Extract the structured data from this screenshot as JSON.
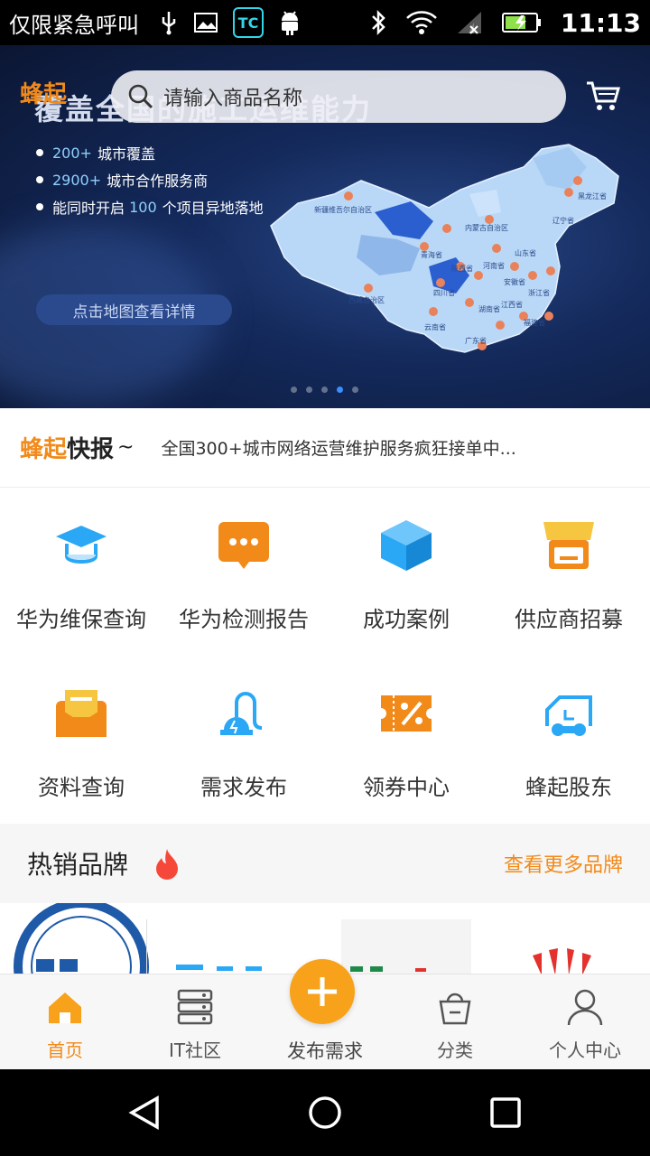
{
  "status_bar": {
    "carrier": "仅限紧急呼叫",
    "app_badge": "TC",
    "time": "11:13"
  },
  "banner": {
    "logo_text": "蜂起",
    "title": "覆盖全国的施工运维能力",
    "search_placeholder": "请输入商品名称",
    "bullets": [
      {
        "highlight": "200+",
        "text": "城市覆盖"
      },
      {
        "highlight": "2900+",
        "text": "城市合作服务商"
      },
      {
        "highlight": "100",
        "prefix": "能同时开启",
        "text": "个项目异地落地"
      }
    ],
    "map_button": "点击地图查看详情",
    "map_labels": [
      "新疆维吾尔自治区",
      "西藏自治区",
      "内蒙古自治区",
      "青海省",
      "四川省",
      "云南省",
      "广东省",
      "湖南省",
      "江西省",
      "浙江省",
      "山东省",
      "辽宁省",
      "黑龙江省",
      "陕西省",
      "河南省",
      "安徽省",
      "福建省"
    ],
    "carousel_pages": 5,
    "carousel_active": 4
  },
  "news": {
    "brand_orange": "蜂起",
    "brand_dark": "快报",
    "tilde": "~",
    "text": "全国300+城市网络运营维护服务疯狂接单中..."
  },
  "grid_items": [
    {
      "label": "华为维保查询",
      "icon": "graduation-cap-icon",
      "color": "#2aa7f5"
    },
    {
      "label": "华为检测报告",
      "icon": "chat-bubble-icon",
      "color": "#f28a1a"
    },
    {
      "label": "成功案例",
      "icon": "cube-icon",
      "color": "#2aa7f5"
    },
    {
      "label": "供应商招募",
      "icon": "storefront-icon",
      "color": "#f7b52a"
    },
    {
      "label": "资料查询",
      "icon": "envelope-icon",
      "color": "#f28a1a"
    },
    {
      "label": "需求发布",
      "icon": "vacuum-icon",
      "color": "#2aa7f5"
    },
    {
      "label": "领券中心",
      "icon": "coupon-icon",
      "color": "#f28a1a"
    },
    {
      "label": "蜂起股东",
      "icon": "truck-icon",
      "color": "#2aa7f5"
    }
  ],
  "hot": {
    "title": "热销品牌",
    "more": "查看更多品牌"
  },
  "tabs": [
    {
      "label": "首页",
      "icon": "home-icon",
      "active": true
    },
    {
      "label": "IT社区",
      "icon": "server-icon",
      "active": false
    },
    {
      "label": "发布需求",
      "icon": "plus-icon",
      "active": false
    },
    {
      "label": "分类",
      "icon": "basket-icon",
      "active": false
    },
    {
      "label": "个人中心",
      "icon": "person-icon",
      "active": false
    }
  ],
  "colors": {
    "accent": "#f28a1a",
    "blue": "#2aa7f5",
    "publish": "#f7a21a"
  }
}
